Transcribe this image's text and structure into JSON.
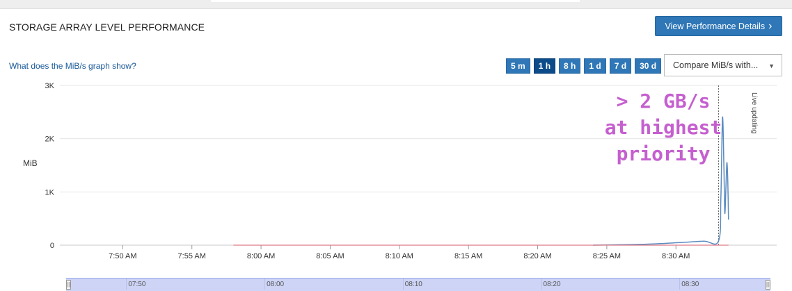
{
  "panel": {
    "title": "STORAGE ARRAY LEVEL PERFORMANCE",
    "details_button": "View Performance Details",
    "details_chevron": "›",
    "help_link": "What does the MiB/s graph show?"
  },
  "time_range_buttons": [
    {
      "label": "5 m",
      "active": false
    },
    {
      "label": "1 h",
      "active": true
    },
    {
      "label": "8 h",
      "active": false
    },
    {
      "label": "1 d",
      "active": false
    },
    {
      "label": "7 d",
      "active": false
    },
    {
      "label": "30 d",
      "active": false
    }
  ],
  "compare_select": {
    "value": "Compare MiB/s with...",
    "caret": "▼"
  },
  "annotation": "> 2 GB/s\nat highest\npriority",
  "live_label": "Live updating",
  "chart_data": {
    "type": "line",
    "ylabel": "MiB",
    "ylim": [
      0,
      3000
    ],
    "yticks": [
      {
        "value": 0,
        "label": "0"
      },
      {
        "value": 1000,
        "label": "1K"
      },
      {
        "value": 2000,
        "label": "2K"
      },
      {
        "value": 3000,
        "label": "3K"
      }
    ],
    "xlim": [
      "07:45",
      "08:35"
    ],
    "xticks": [
      {
        "t": "07:50",
        "label": "7:50 AM"
      },
      {
        "t": "07:55",
        "label": "7:55 AM"
      },
      {
        "t": "08:00",
        "label": "8:00 AM"
      },
      {
        "t": "08:05",
        "label": "8:05 AM"
      },
      {
        "t": "08:10",
        "label": "8:10 AM"
      },
      {
        "t": "08:15",
        "label": "8:15 AM"
      },
      {
        "t": "08:20",
        "label": "8:20 AM"
      },
      {
        "t": "08:25",
        "label": "8:25 AM"
      },
      {
        "t": "08:30",
        "label": "8:30 AM"
      }
    ],
    "grid": true,
    "series": [
      {
        "color": "#5b8bbf",
        "points": [
          [
            "08:24",
            0
          ],
          [
            "08:26",
            8
          ],
          [
            "08:28",
            20
          ],
          [
            "08:30",
            45
          ],
          [
            "08:32",
            75
          ],
          [
            "08:33:05",
            80
          ],
          [
            "08:33:15",
            900
          ],
          [
            "08:33:22",
            2400
          ],
          [
            "08:33:28",
            1500
          ],
          [
            "08:33:32",
            600
          ],
          [
            "08:33:37",
            1100
          ],
          [
            "08:33:41",
            1550
          ],
          [
            "08:33:45",
            1200
          ],
          [
            "08:33:48",
            480
          ]
        ]
      },
      {
        "color": "#e07a86",
        "points": [
          [
            "07:58",
            0
          ],
          [
            "08:33:48",
            0
          ]
        ]
      }
    ],
    "live_marker_time": "08:33:05"
  },
  "navigator": {
    "ticks": [
      "07:50",
      "08:00",
      "08:10",
      "08:20",
      "08:30"
    ],
    "handle_glyph": "|||"
  }
}
